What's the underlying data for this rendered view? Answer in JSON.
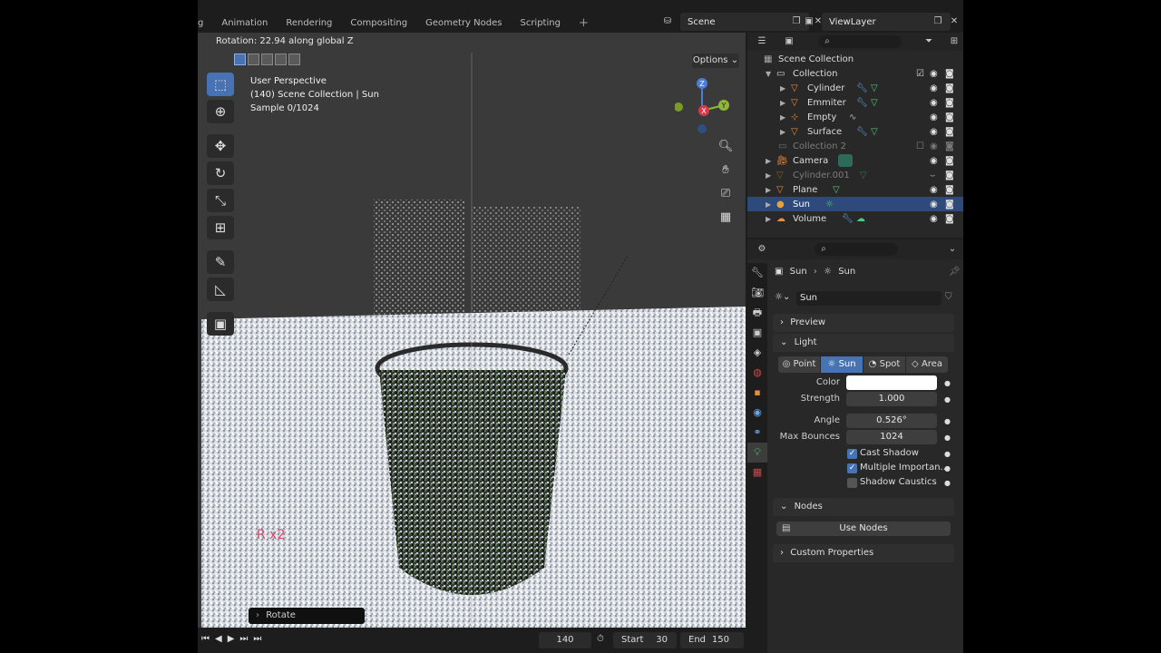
{
  "workspaces": [
    "g",
    "Animation",
    "Rendering",
    "Compositing",
    "Geometry Nodes",
    "Scripting",
    "+"
  ],
  "scene": {
    "label": "Scene"
  },
  "view_layer": {
    "label": "ViewLayer"
  },
  "viewport": {
    "status": "Rotation: 22.94 along global Z",
    "options_label": "Options",
    "overlay": {
      "perspective": "User Perspective",
      "collection": "(140) Scene Collection | Sun",
      "sample": "Sample 0/1024"
    },
    "key_hint": "R x2",
    "operator_panel": "Rotate"
  },
  "timeline": {
    "current_frame": "140",
    "start_label": "Start",
    "start_value": "30",
    "end_label": "End",
    "end_value": "150"
  },
  "outliner": {
    "root": "Scene Collection",
    "rows": [
      {
        "name": "Collection",
        "indent": 1,
        "kind": "collection"
      },
      {
        "name": "Cylinder",
        "indent": 2,
        "kind": "mesh"
      },
      {
        "name": "Emmiter",
        "indent": 2,
        "kind": "mesh"
      },
      {
        "name": "Empty",
        "indent": 2,
        "kind": "empty"
      },
      {
        "name": "Surface",
        "indent": 2,
        "kind": "mesh"
      },
      {
        "name": "Collection 2",
        "indent": 1,
        "kind": "collection-dim"
      },
      {
        "name": "Camera",
        "indent": 1,
        "kind": "camera"
      },
      {
        "name": "Cylinder.001",
        "indent": 1,
        "kind": "mesh-dim"
      },
      {
        "name": "Plane",
        "indent": 1,
        "kind": "mesh"
      },
      {
        "name": "Sun",
        "indent": 1,
        "kind": "light"
      },
      {
        "name": "Volume",
        "indent": 1,
        "kind": "volume"
      }
    ]
  },
  "properties": {
    "breadcrumb_object": "Sun",
    "breadcrumb_data": "Sun",
    "data_name": "Sun",
    "preview_label": "Preview",
    "light_label": "Light",
    "light_types": [
      "Point",
      "Sun",
      "Spot",
      "Area"
    ],
    "active_light_type": "Sun",
    "color_label": "Color",
    "color_value": "#ffffff",
    "strength_label": "Strength",
    "strength_value": "1.000",
    "angle_label": "Angle",
    "angle_value": "0.526°",
    "max_bounces_label": "Max Bounces",
    "max_bounces_value": "1024",
    "cast_shadow_label": "Cast Shadow",
    "cast_shadow": true,
    "mis_label": "Multiple Importan...",
    "mis": true,
    "shadow_caustics_label": "Shadow Caustics",
    "shadow_caustics": false,
    "nodes_label": "Nodes",
    "use_nodes_label": "Use Nodes",
    "custom_props_label": "Custom Properties"
  },
  "colors": {
    "accent": "#4772b3",
    "mesh_icon": "#e88e3c",
    "light_icon": "#e6a23c",
    "data_green": "#4fc87a",
    "data_blue": "#6aa5e8",
    "key_hint": "#d24c6c"
  }
}
